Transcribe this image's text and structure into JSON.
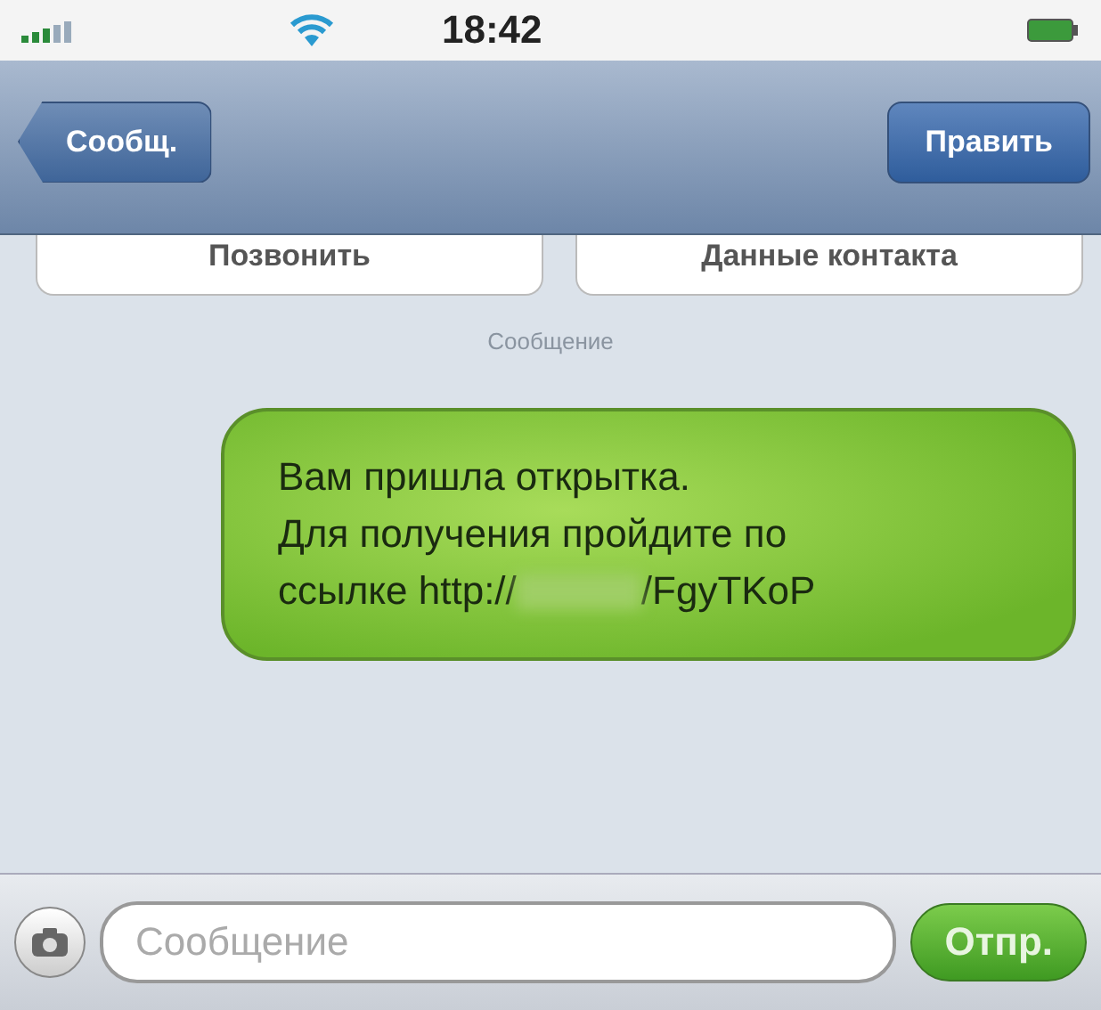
{
  "status_bar": {
    "time": "18:42"
  },
  "nav_bar": {
    "back_button": "Сообщ.",
    "edit_button": "Править"
  },
  "contact_buttons": [
    "Позвонить",
    "Данные контакта"
  ],
  "thread_label": "Сообщение",
  "messages": [
    {
      "lines": [
        "Вам пришла открытка.",
        "Для получения пройдите по"
      ],
      "link_before": "ссылке http://",
      "link_after": "/FgyTKoP",
      "redacted": true
    }
  ],
  "compose": {
    "placeholder": "Сообщение",
    "send_button": "Отпр."
  }
}
